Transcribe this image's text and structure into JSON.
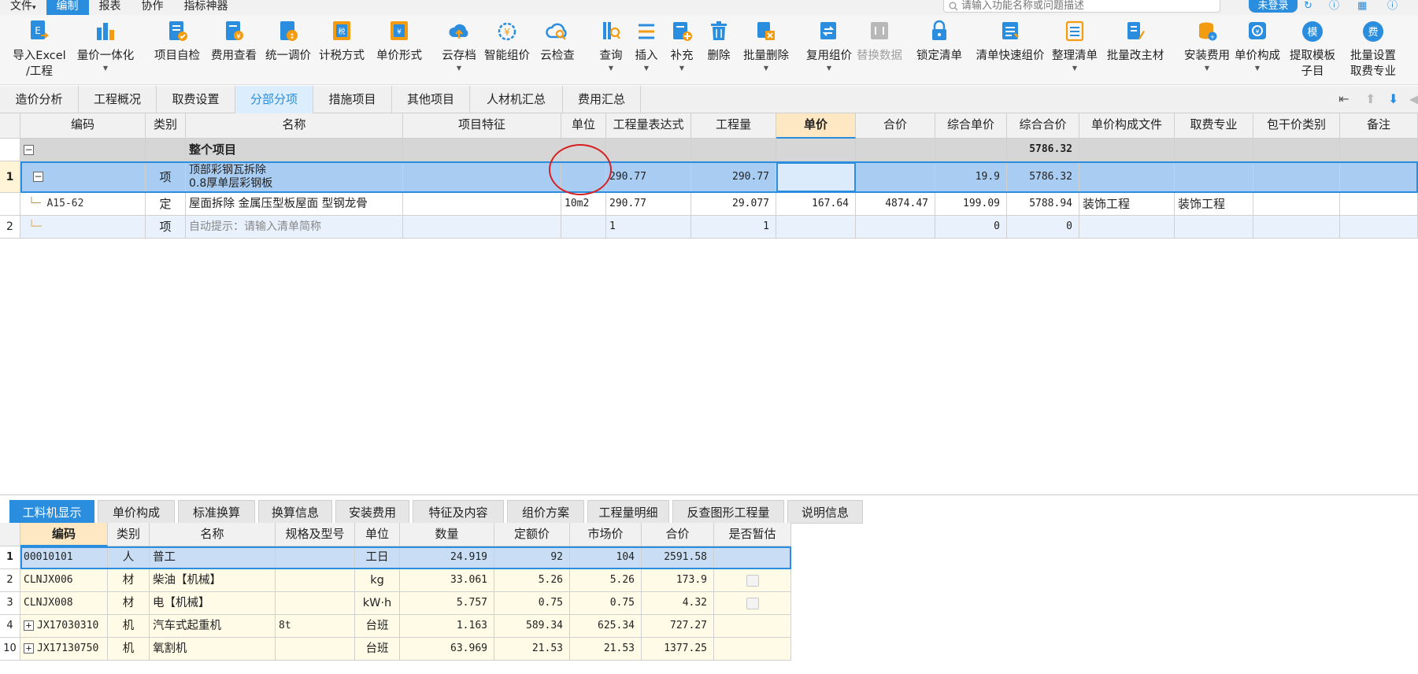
{
  "menu": {
    "items": [
      "文件",
      "编制",
      "报表",
      "协作",
      "指标神器"
    ],
    "search_placeholder": "请输入功能名称或问题描述",
    "login_label": "未登录"
  },
  "ribbon": {
    "buttons": [
      {
        "id": "import-excel",
        "label": "导入Excel",
        "label2": "/工程",
        "icon": "import-excel-icon"
      },
      {
        "id": "quantity-price",
        "label": "量价一体化",
        "label2": "",
        "icon": "quantity-price-icon"
      },
      {
        "id": "self-check",
        "label": "项目自检",
        "label2": "",
        "icon": "project-check-icon"
      },
      {
        "id": "fee-view",
        "label": "费用查看",
        "label2": "",
        "icon": "fee-view-icon"
      },
      {
        "id": "unified-adjust",
        "label": "统一调价",
        "label2": "",
        "icon": "unified-adjust-icon"
      },
      {
        "id": "tax-method",
        "label": "计税方式",
        "label2": "",
        "icon": "tax-method-icon"
      },
      {
        "id": "unit-price-form",
        "label": "单价形式",
        "label2": "",
        "icon": "unit-price-form-icon"
      },
      {
        "id": "cloud-archive",
        "label": "云存档",
        "label2": "",
        "icon": "cloud-upload-icon"
      },
      {
        "id": "smart-price",
        "label": "智能组价",
        "label2": "",
        "icon": "smart-price-icon"
      },
      {
        "id": "cloud-check",
        "label": "云检查",
        "label2": "",
        "icon": "cloud-check-icon"
      },
      {
        "id": "query",
        "label": "查询",
        "label2": "",
        "icon": "query-icon"
      },
      {
        "id": "insert",
        "label": "插入",
        "label2": "",
        "icon": "insert-icon"
      },
      {
        "id": "supplement",
        "label": "补充",
        "label2": "",
        "icon": "supplement-icon"
      },
      {
        "id": "delete",
        "label": "删除",
        "label2": "",
        "icon": "trash-icon"
      },
      {
        "id": "batch-delete",
        "label": "批量删除",
        "label2": "",
        "icon": "batch-delete-icon"
      },
      {
        "id": "reuse-price",
        "label": "复用组价",
        "label2": "",
        "icon": "reuse-price-icon"
      },
      {
        "id": "replace-data",
        "label": "替换数据",
        "label2": "",
        "icon": "replace-data-icon"
      },
      {
        "id": "lock-list",
        "label": "锁定清单",
        "label2": "",
        "icon": "lock-icon"
      },
      {
        "id": "quick-price",
        "label": "清单快速组价",
        "label2": "",
        "icon": "quick-price-icon"
      },
      {
        "id": "organize-list",
        "label": "整理清单",
        "label2": "",
        "icon": "organize-list-icon"
      },
      {
        "id": "batch-main-material",
        "label": "批量改主材",
        "label2": "",
        "icon": "batch-edit-icon"
      },
      {
        "id": "install-fee",
        "label": "安装费用",
        "label2": "",
        "icon": "install-fee-icon"
      },
      {
        "id": "unit-price-comp",
        "label": "单价构成",
        "label2": "",
        "icon": "unit-price-comp-icon"
      },
      {
        "id": "extract-template",
        "label": "提取模板",
        "label2": "子目",
        "icon": "template-icon"
      },
      {
        "id": "batch-fee-specialty",
        "label": "批量设置",
        "label2": "取费专业",
        "icon": "fee-specialty-icon"
      }
    ],
    "template_glyph": "模",
    "fee_glyph": "费"
  },
  "main_tabs": [
    "造价分析",
    "工程概况",
    "取费设置",
    "分部分项",
    "措施项目",
    "其他项目",
    "人材机汇总",
    "费用汇总"
  ],
  "upper_grid": {
    "headers": [
      "编码",
      "类别",
      "名称",
      "项目特征",
      "单位",
      "工程量表达式",
      "工程量",
      "单价",
      "合价",
      "综合单价",
      "综合合价",
      "单价构成文件",
      "取费专业",
      "包干价类别",
      "备注"
    ],
    "summary": {
      "name": "整个项目",
      "total": "5786.32"
    },
    "rows": [
      {
        "no": "1",
        "code": "",
        "type": "项",
        "name1": "顶部彩钢瓦拆除",
        "name2": "0.8厚单层彩钢板",
        "feature": "",
        "unit": "",
        "expr": "290.77",
        "qty": "290.77",
        "price": "",
        "amount": "",
        "comp_price": "19.9",
        "comp_amount": "5786.32",
        "file": "",
        "specialty": "",
        "pkg": "",
        "note": ""
      },
      {
        "no": "",
        "code": "A15-62",
        "type": "定",
        "name1": "屋面拆除 金属压型板屋面 型钢龙骨",
        "name2": "",
        "feature": "",
        "unit": "10m2",
        "expr": "290.77",
        "qty": "29.077",
        "price": "167.64",
        "amount": "4874.47",
        "comp_price": "199.09",
        "comp_amount": "5788.94",
        "file": "装饰工程",
        "specialty": "装饰工程",
        "pkg": "",
        "note": ""
      },
      {
        "no": "2",
        "code": "",
        "type": "项",
        "name1": "自动提示：请输入清单简称",
        "name2": "",
        "feature": "",
        "unit": "",
        "expr": "1",
        "qty": "1",
        "price": "",
        "amount": "",
        "comp_price": "0",
        "comp_amount": "0",
        "file": "",
        "specialty": "",
        "pkg": "",
        "note": ""
      }
    ]
  },
  "bottom_tabs": [
    "工料机显示",
    "单价构成",
    "标准换算",
    "换算信息",
    "安装费用",
    "特征及内容",
    "组价方案",
    "工程量明细",
    "反查图形工程量",
    "说明信息"
  ],
  "lower_grid": {
    "headers": [
      "编码",
      "类别",
      "名称",
      "规格及型号",
      "单位",
      "数量",
      "定额价",
      "市场价",
      "合价",
      "是否暂估"
    ],
    "rows": [
      {
        "no": "1",
        "code": "00010101",
        "type": "人",
        "name": "普工",
        "spec": "",
        "unit": "工日",
        "qty": "24.919",
        "base": "92",
        "market": "104",
        "total": "2591.58",
        "expand": false,
        "check": false
      },
      {
        "no": "2",
        "code": "CLNJX006",
        "type": "材",
        "name": "柴油【机械】",
        "spec": "",
        "unit": "kg",
        "qty": "33.061",
        "base": "5.26",
        "market": "5.26",
        "total": "173.9",
        "expand": false,
        "check": true
      },
      {
        "no": "3",
        "code": "CLNJX008",
        "type": "材",
        "name": "电【机械】",
        "spec": "",
        "unit": "kW·h",
        "qty": "5.757",
        "base": "0.75",
        "market": "0.75",
        "total": "4.32",
        "expand": false,
        "check": true
      },
      {
        "no": "4",
        "code": "JX17030310",
        "type": "机",
        "name": "汽车式起重机",
        "spec": "8t",
        "unit": "台班",
        "qty": "1.163",
        "base": "589.34",
        "market": "625.34",
        "total": "727.27",
        "expand": true,
        "check": false
      },
      {
        "no": "10",
        "code": "JX17130750",
        "type": "机",
        "name": "氧割机",
        "spec": "",
        "unit": "台班",
        "qty": "63.969",
        "base": "21.53",
        "market": "21.53",
        "total": "1377.25",
        "expand": true,
        "check": false
      }
    ]
  },
  "colors": {
    "accent": "#2a8dde",
    "selection": "#c9def5",
    "highlight_header": "#fde8c3",
    "annotation": "#d62020"
  }
}
